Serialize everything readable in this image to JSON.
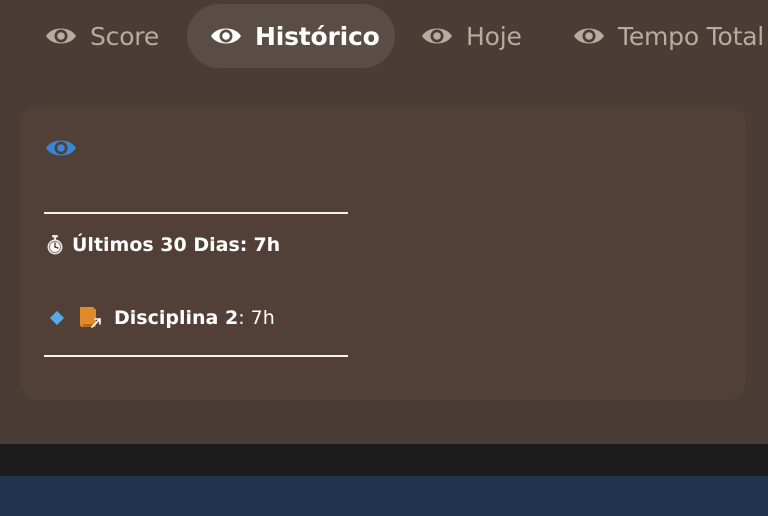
{
  "tabs": [
    {
      "label": "Score",
      "icon": "eye-icon",
      "active": false
    },
    {
      "label": "Histórico",
      "icon": "eye-icon",
      "active": true
    },
    {
      "label": "Hoje",
      "icon": "eye-icon",
      "active": false
    },
    {
      "label": "Tempo Total",
      "icon": "eye-icon",
      "active": false
    }
  ],
  "card": {
    "header_icon": "eye-icon",
    "total_label": "Últimos 30 Dias:",
    "total_value": "7h",
    "discipline_label": "Disciplina 2",
    "discipline_value": ": 7h"
  },
  "colors": {
    "background": "#4a3d36",
    "card": "#523f37",
    "active_tab": "#5a4d45",
    "accent_blue": "#3a86d6",
    "footer_blue": "#22354f",
    "book_orange": "#e08a2c"
  }
}
